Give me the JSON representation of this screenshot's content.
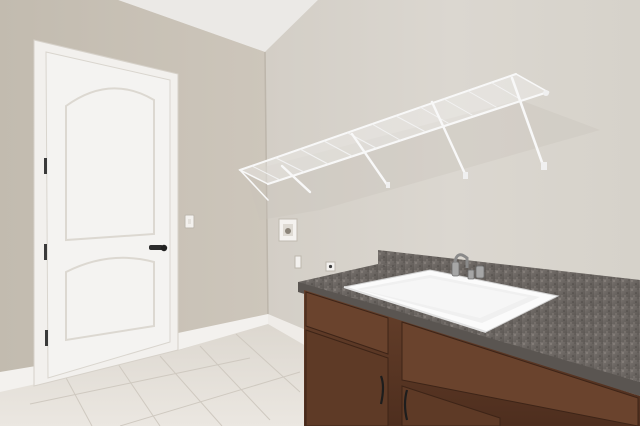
{
  "scene": {
    "kind": "photo",
    "subject": "laundry room",
    "objects": [
      "door",
      "door-handle",
      "light-switch",
      "dryer-vent-box",
      "wall-outlet",
      "wire-shelf",
      "cabinet",
      "granite-countertop",
      "utility-sink",
      "faucet",
      "tile-floor",
      "baseboard"
    ]
  },
  "palette": {
    "wall_left": "#cbc4b9",
    "wall_right": "#d9d5cd",
    "ceiling": "#ebe9e6",
    "door": "#f4f3f1",
    "trim": "#f2f0ed",
    "floor": "#e4e0da",
    "cabinet": "#5a3624",
    "countertop": "#6f6a66",
    "sink": "#fbfbfb"
  }
}
